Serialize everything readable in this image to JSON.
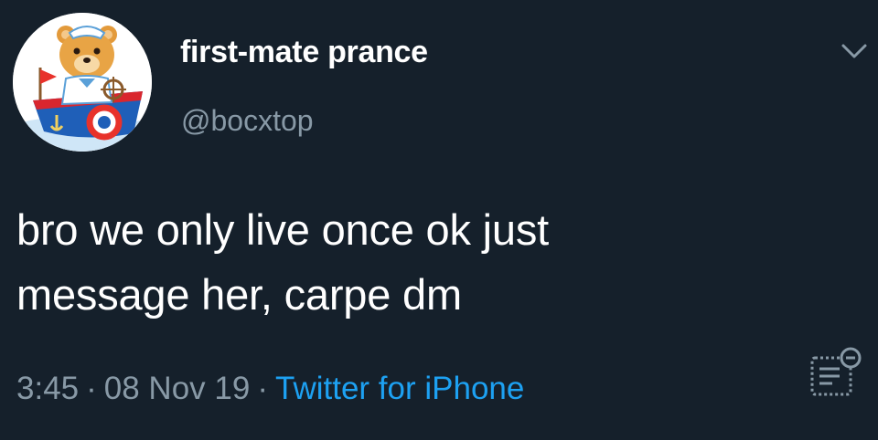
{
  "tweet": {
    "author": {
      "display_name": "first-mate prance",
      "handle": "@bocxtop",
      "avatar_icon": "teddy-bear-sailor-boat-avatar"
    },
    "text_lines": [
      "bro we only live once ok just",
      "message her, carpe dm"
    ],
    "time": "3:45",
    "date": "08 Nov 19",
    "separator": "·",
    "source": "Twitter for iPhone",
    "menu_icon": "chevron-down-icon",
    "analytics_icon": "analytics-icon"
  },
  "colors": {
    "background": "#15202b",
    "primary_text": "#ffffff",
    "secondary_text": "#8899a6",
    "link": "#1da1f2"
  }
}
